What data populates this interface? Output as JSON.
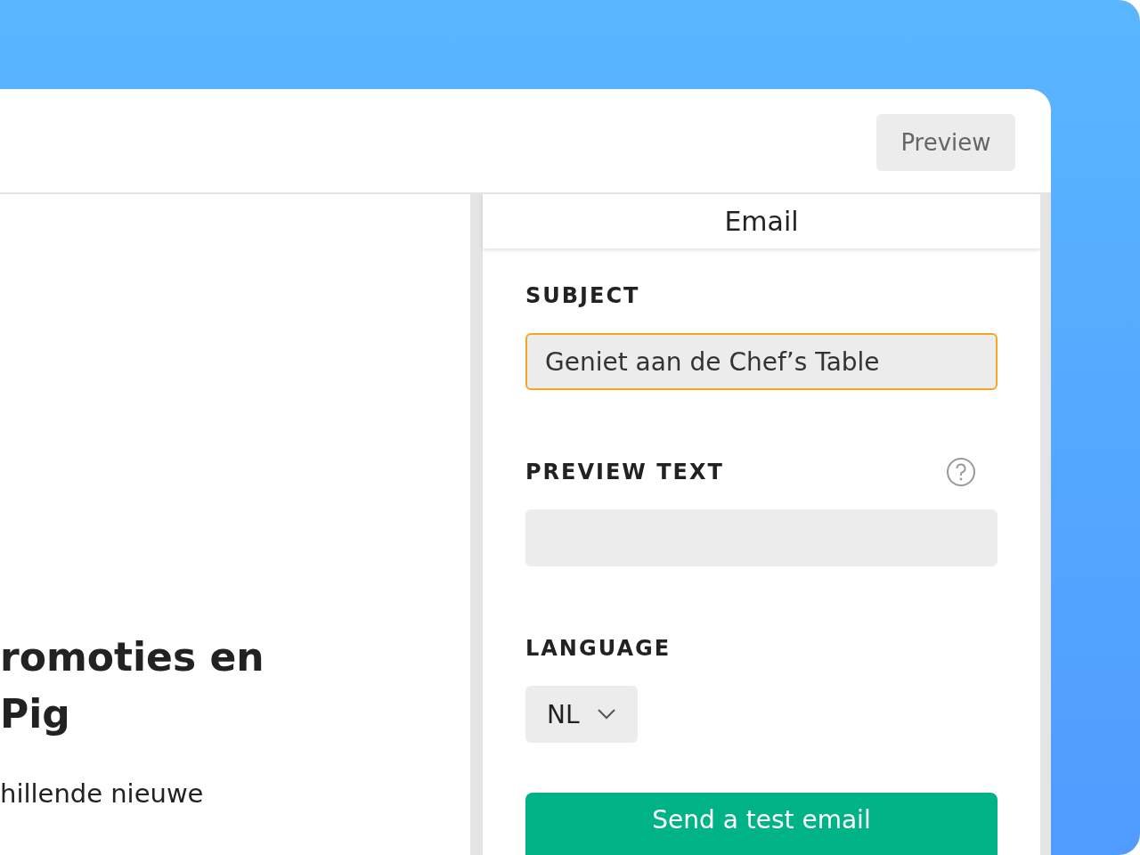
{
  "header": {
    "preview_button": "Preview"
  },
  "content": {
    "heading_lines": [
      "romoties en",
      "Pig"
    ],
    "body": "hillende nieuwe"
  },
  "panel": {
    "title": "Email",
    "subject": {
      "label": "SUBJECT",
      "value": "Geniet aan de Chef’s Table",
      "focused": true
    },
    "preview_text": {
      "label": "PREVIEW TEXT"
    },
    "language": {
      "label": "LANGUAGE",
      "value": "NL"
    },
    "test_button": "Send a test email"
  }
}
